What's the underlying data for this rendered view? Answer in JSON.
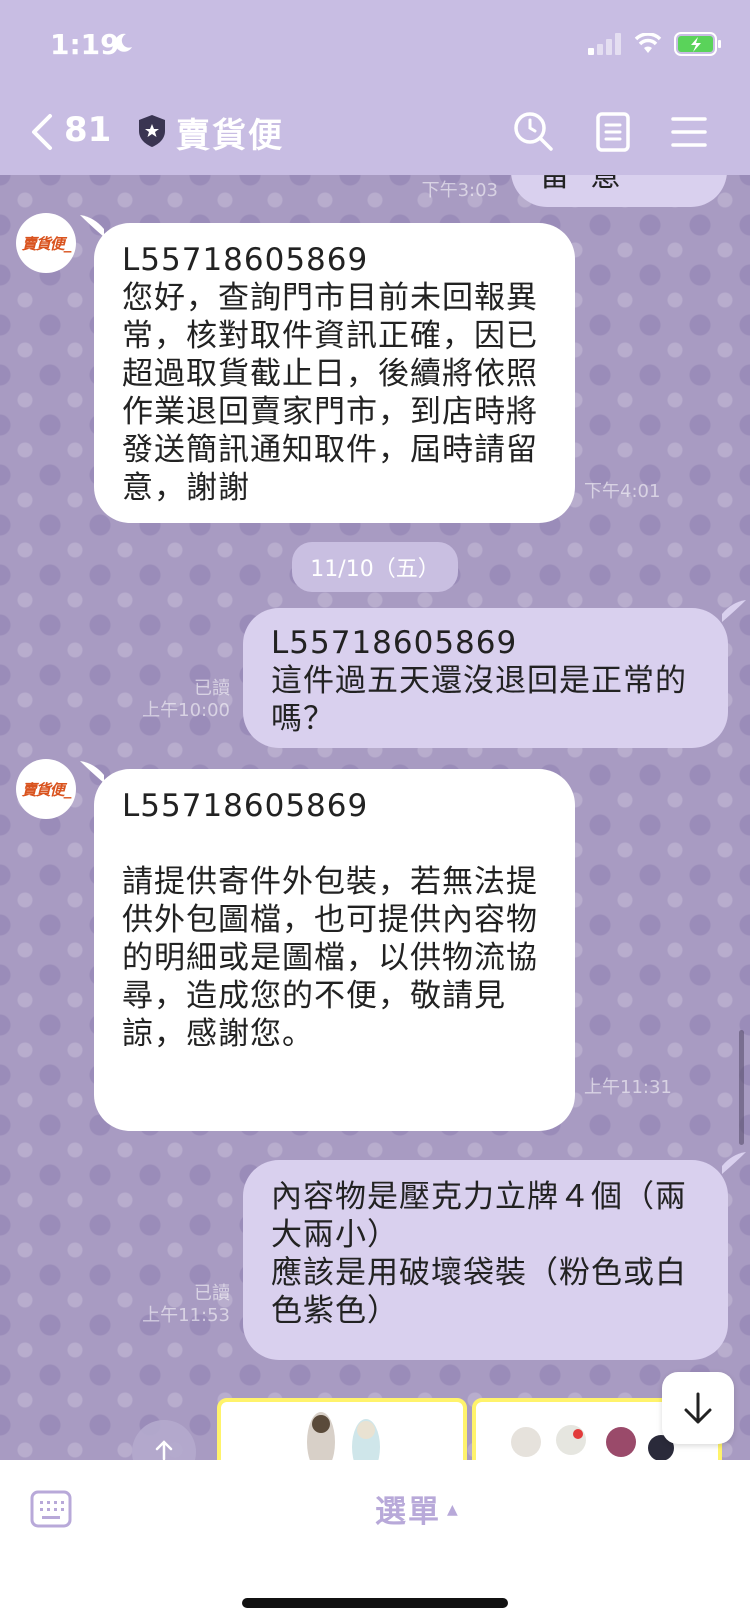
{
  "status_bar": {
    "time": "1:19"
  },
  "header": {
    "back_count": "81",
    "title": "賣貨便"
  },
  "messages": [
    {
      "partial_text": "留意",
      "time": "下午3:03"
    },
    {
      "text": "L55718605869\n您好，查詢門市目前未回報異常，核對取件資訊正確，因已超過取貨截止日，後續將依照作業退回賣家門市，到店時將發送簡訊通知取件，屆時請留意，謝謝",
      "time": "下午4:01",
      "avatar": "賣貨便_"
    },
    {
      "date": "11/10（五）"
    },
    {
      "text": "L55718605869\n這件過五天還沒退回是正常的嗎？",
      "read": "已讀",
      "time": "上午10:00"
    },
    {
      "text": "L55718605869\n\n請提供寄件外包裝，若無法提供外包圖檔，也可提供內容物的明細或是圖檔，以供物流協尋，造成您的不便，敬請見諒，感謝您。",
      "time": "上午11:31",
      "avatar": "賣貨便_"
    },
    {
      "text": "內容物是壓克力立牌４個（兩大兩小）\n應該是用破壞袋裝（粉色或白色紫色）",
      "read": "已讀",
      "time": "上午11:53"
    }
  ],
  "bottom_bar": {
    "menu_label": "選單",
    "menu_arrow": "▲"
  },
  "colors": {
    "header": "#c8bde3",
    "chat_bg": "#a89bc2",
    "outgoing": "#d9d0ee",
    "accent": "#b8a9d9"
  },
  "icons": [
    "moon-icon",
    "signal-icon",
    "wifi-icon",
    "battery-icon",
    "back-icon",
    "shield-icon",
    "search-icon",
    "notes-icon",
    "menu-icon",
    "keyboard-icon",
    "arrow-down-icon",
    "share-icon"
  ]
}
